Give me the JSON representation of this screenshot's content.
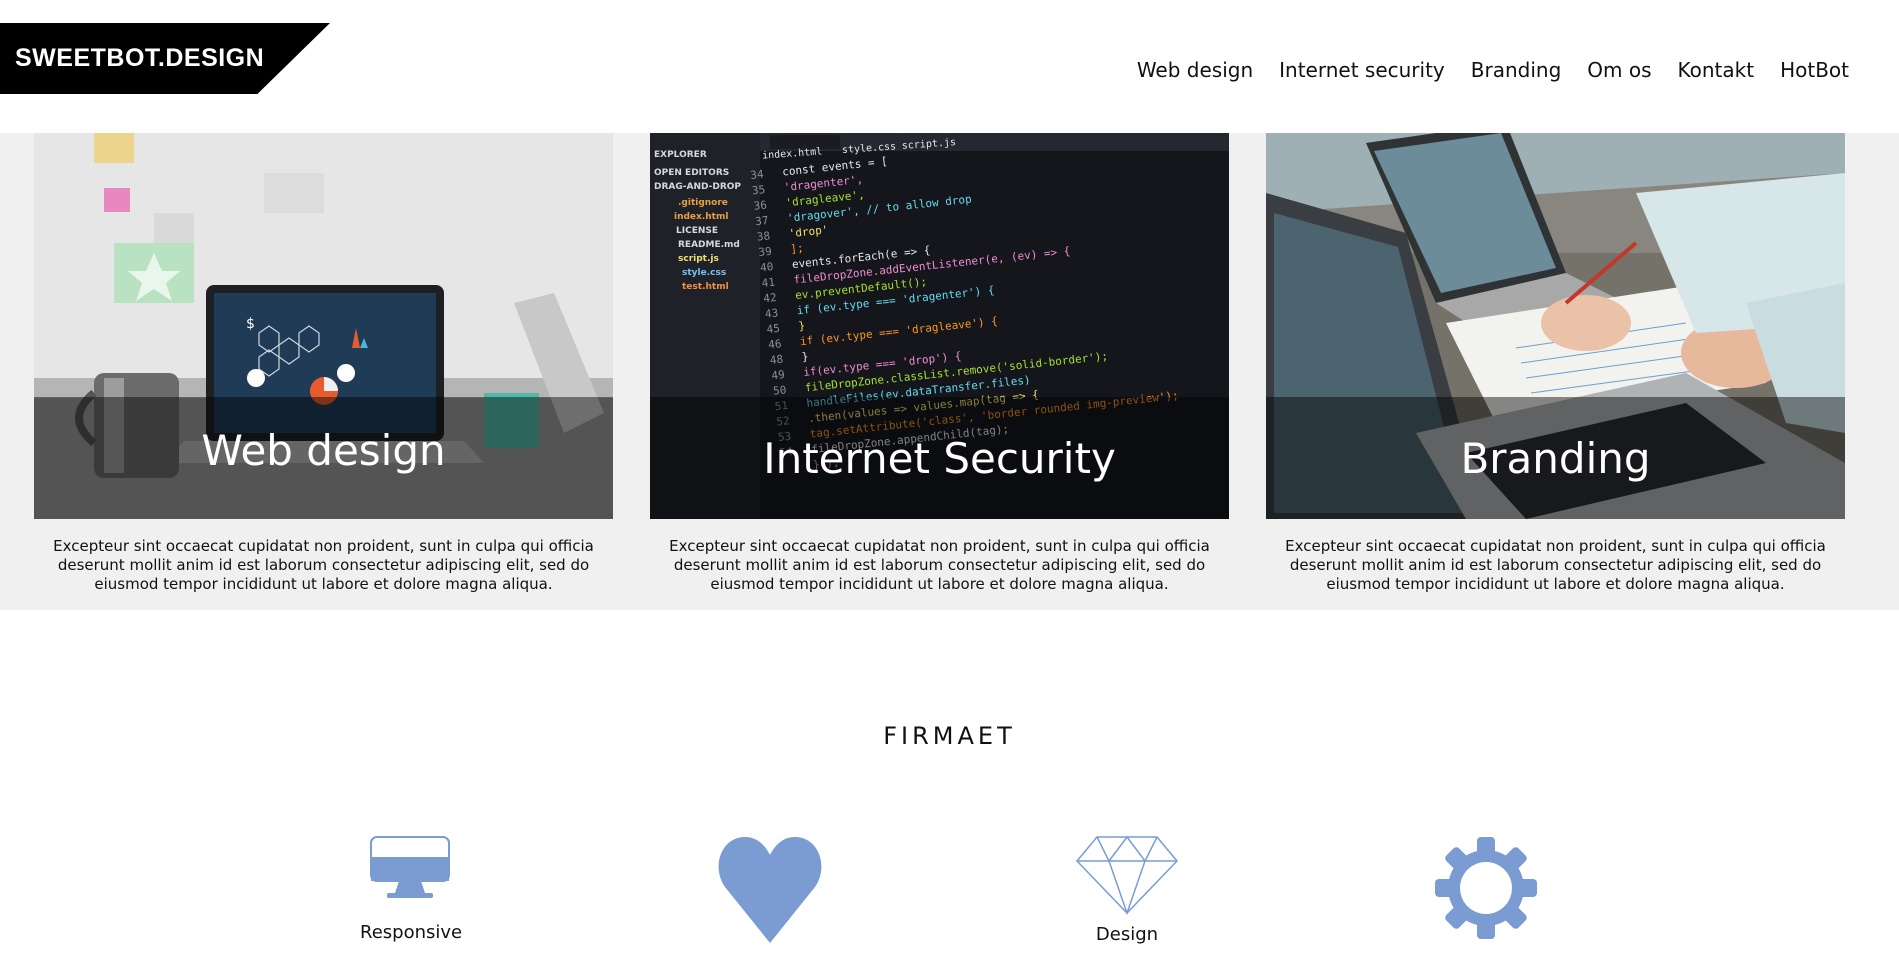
{
  "header": {
    "logo_text": "SWEETBOT.DESIGN",
    "nav": [
      "Web design",
      "Internet security",
      "Branding",
      "Om os",
      "Kontakt",
      "HotBot"
    ]
  },
  "cards": [
    {
      "title": "Web design",
      "text": "Excepteur sint occaecat cupidatat non proident, sunt in culpa qui officia deserunt mollit anim id est laborum consectetur adipiscing elit, sed do eiusmod tempor incididunt ut labore et dolore magna aliqua."
    },
    {
      "title": "Internet Security",
      "text": "Excepteur sint occaecat cupidatat non proident, sunt in culpa qui officia deserunt mollit anim id est laborum consectetur adipiscing elit, sed do eiusmod tempor incididunt ut labore et dolore magna aliqua."
    },
    {
      "title": "Branding",
      "text": "Excepteur sint occaecat cupidatat non proident, sunt in culpa qui officia deserunt mollit anim id est laborum consectetur adipiscing elit, sed do eiusmod tempor incididunt ut labore et dolore magna aliqua."
    }
  ],
  "section": {
    "title": "FIRMAET"
  },
  "features": [
    {
      "icon": "monitor-icon",
      "label": "Responsive"
    },
    {
      "icon": "heart-icon",
      "label": ""
    },
    {
      "icon": "diamond-icon",
      "label": "Design"
    },
    {
      "icon": "gear-icon",
      "label": ""
    }
  ],
  "colors": {
    "accent_icon": "#7a9cd3",
    "header_bg": "#ffffff",
    "cards_bg": "#f0f0f0",
    "logo_bg": "#000000"
  },
  "code_lines": [
    {
      "n": "34",
      "t": "const events = ["
    },
    {
      "n": "35",
      "t": "  'dragenter',"
    },
    {
      "n": "36",
      "t": "  'dragleave',"
    },
    {
      "n": "37",
      "t": "  'dragover', // to allow drop"
    },
    {
      "n": "38",
      "t": "  'drop'"
    },
    {
      "n": "39",
      "t": "];"
    },
    {
      "n": "40",
      "t": "events.forEach(e => {"
    },
    {
      "n": "41",
      "t": "  fileDropZone.addEventListener(e, (ev) => {"
    },
    {
      "n": "42",
      "t": "    ev.preventDefault();"
    },
    {
      "n": "43",
      "t": "    if (ev.type === 'dragenter') {"
    },
    {
      "n": "45",
      "t": "    }"
    },
    {
      "n": "46",
      "t": "    if (ev.type === 'dragleave') {"
    },
    {
      "n": "48",
      "t": "    }"
    },
    {
      "n": "49",
      "t": "    if(ev.type === 'drop') {"
    },
    {
      "n": "50",
      "t": "      fileDropZone.classList.remove('solid-border');"
    },
    {
      "n": "51",
      "t": "      handleFiles(ev.dataTransfer.files)"
    },
    {
      "n": "52",
      "t": "        .then(values => values.map(tag => {"
    },
    {
      "n": "53",
      "t": "          tag.setAttribute('class', 'border rounded img-preview');"
    },
    {
      "n": "54",
      "t": "          fileDropZone.appendChild(tag);"
    },
    {
      "n": "",
      "t": "        }));"
    }
  ],
  "file_tree": [
    "EXPLORER",
    "OPEN EDITORS",
    "DRAG-AND-DROP",
    ".gitignore",
    "index.html",
    "LICENSE",
    "README.md",
    "script.js",
    "style.css",
    "test.html"
  ],
  "editor_tabs": [
    "index.html",
    "style.css",
    "script.js"
  ]
}
